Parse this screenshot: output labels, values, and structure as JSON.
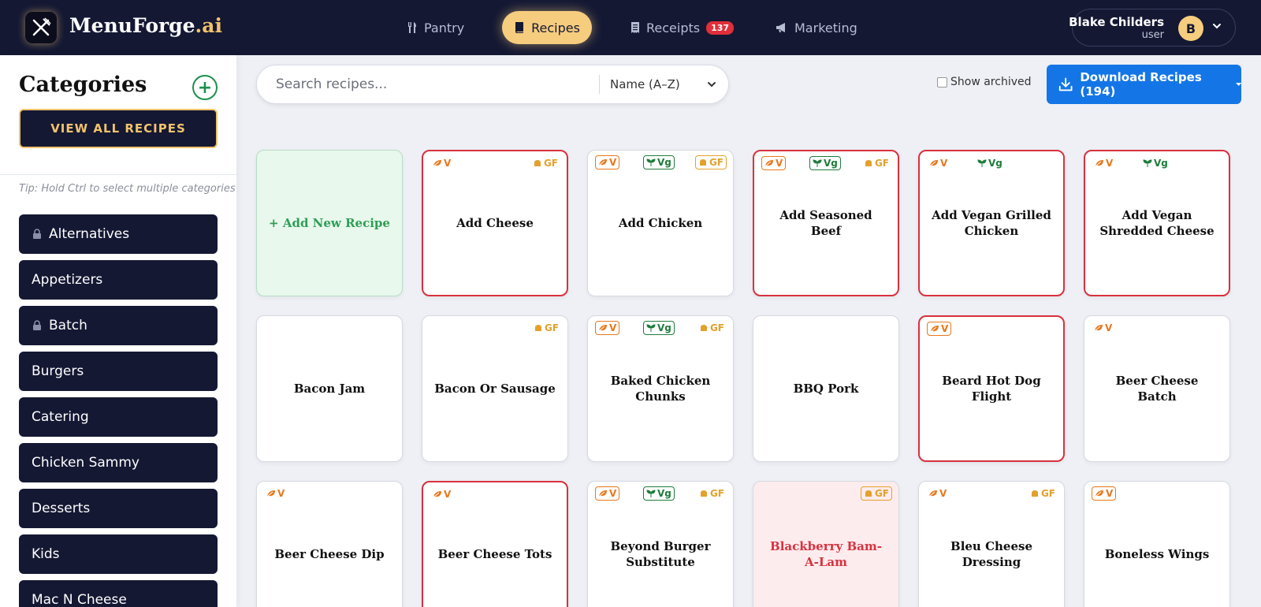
{
  "app": {
    "brand": "MenuForge",
    "brand_suffix": ".ai"
  },
  "nav": {
    "pantry": "Pantry",
    "recipes": "Recipes",
    "receipts": "Receipts",
    "receipts_badge": "137",
    "marketing": "Marketing",
    "active": "recipes"
  },
  "user": {
    "name": "Blake Childers",
    "role": "user",
    "initial": "B"
  },
  "sidebar": {
    "title": "Categories",
    "add_label": "+",
    "view_all": "VIEW ALL RECIPES",
    "tip": "Tip: Hold Ctrl to select multiple categories",
    "categories": [
      {
        "label": "Alternatives",
        "locked": true
      },
      {
        "label": "Appetizers",
        "locked": false
      },
      {
        "label": "Batch",
        "locked": true
      },
      {
        "label": "Burgers",
        "locked": false
      },
      {
        "label": "Catering",
        "locked": false
      },
      {
        "label": "Chicken Sammy",
        "locked": false
      },
      {
        "label": "Desserts",
        "locked": false
      },
      {
        "label": "Kids",
        "locked": false
      },
      {
        "label": "Mac N Cheese",
        "locked": false
      }
    ]
  },
  "toolbar": {
    "search_placeholder": "Search recipes...",
    "sort_value": "Name (A–Z)",
    "show_archived": "Show archived",
    "download_label": "Download Recipes (194)"
  },
  "tags": {
    "v": "V",
    "vg": "Vg",
    "gf": "GF"
  },
  "recipes": [
    {
      "title": "+ Add New Recipe",
      "kind": "new",
      "tags": []
    },
    {
      "title": "Add Cheese",
      "style": "red",
      "tags": [
        {
          "type": "v",
          "pos": "l",
          "boxed": false
        },
        {
          "type": "gf",
          "pos": "r",
          "boxed": false
        }
      ]
    },
    {
      "title": "Add Chicken",
      "style": "plain",
      "tags": [
        {
          "type": "v",
          "pos": "l",
          "boxed": true
        },
        {
          "type": "vg",
          "pos": "m",
          "boxed": true
        },
        {
          "type": "gf",
          "pos": "r",
          "boxed": true
        }
      ]
    },
    {
      "title": "Add Seasoned Beef",
      "style": "red",
      "tags": [
        {
          "type": "v",
          "pos": "l",
          "boxed": true
        },
        {
          "type": "vg",
          "pos": "m",
          "boxed": true
        },
        {
          "type": "gf",
          "pos": "r",
          "boxed": false
        }
      ]
    },
    {
      "title": "Add Vegan Grilled Chicken",
      "style": "red",
      "tags": [
        {
          "type": "v",
          "pos": "l",
          "boxed": false
        },
        {
          "type": "vg",
          "pos": "m",
          "boxed": false
        }
      ]
    },
    {
      "title": "Add Vegan Shredded Cheese",
      "style": "red",
      "tags": [
        {
          "type": "v",
          "pos": "l",
          "boxed": false
        },
        {
          "type": "vg",
          "pos": "m",
          "boxed": false
        }
      ]
    },
    {
      "title": "Bacon Jam",
      "style": "plain",
      "tags": []
    },
    {
      "title": "Bacon Or Sausage",
      "style": "plain",
      "tags": [
        {
          "type": "gf",
          "pos": "r",
          "boxed": false
        }
      ]
    },
    {
      "title": "Baked Chicken Chunks",
      "style": "plain",
      "tags": [
        {
          "type": "v",
          "pos": "l",
          "boxed": true
        },
        {
          "type": "vg",
          "pos": "m",
          "boxed": true
        },
        {
          "type": "gf",
          "pos": "r",
          "boxed": false
        }
      ]
    },
    {
      "title": "BBQ Pork",
      "style": "plain",
      "tags": []
    },
    {
      "title": "Beard Hot Dog Flight",
      "style": "red",
      "tags": [
        {
          "type": "v",
          "pos": "l",
          "boxed": true
        }
      ]
    },
    {
      "title": "Beer Cheese Batch",
      "style": "plain",
      "tags": [
        {
          "type": "v",
          "pos": "l",
          "boxed": false
        }
      ]
    },
    {
      "title": "Beer Cheese Dip",
      "style": "plain",
      "tags": [
        {
          "type": "v",
          "pos": "l",
          "boxed": false
        }
      ]
    },
    {
      "title": "Beer Cheese Tots",
      "style": "red",
      "tags": [
        {
          "type": "v",
          "pos": "l",
          "boxed": false
        }
      ]
    },
    {
      "title": "Beyond Burger Substitute",
      "style": "plain",
      "tags": [
        {
          "type": "v",
          "pos": "l",
          "boxed": true
        },
        {
          "type": "vg",
          "pos": "m",
          "boxed": true
        },
        {
          "type": "gf",
          "pos": "r",
          "boxed": false
        }
      ]
    },
    {
      "title": "Blackberry Bam-A-Lam",
      "style": "pink",
      "tags": [
        {
          "type": "gf",
          "pos": "r",
          "boxed": true
        }
      ]
    },
    {
      "title": "Bleu Cheese Dressing",
      "style": "plain",
      "tags": [
        {
          "type": "v",
          "pos": "l",
          "boxed": false
        },
        {
          "type": "gf",
          "pos": "r",
          "boxed": false
        }
      ]
    },
    {
      "title": "Boneless Wings",
      "style": "plain",
      "tags": [
        {
          "type": "v",
          "pos": "l",
          "boxed": true
        }
      ]
    }
  ]
}
